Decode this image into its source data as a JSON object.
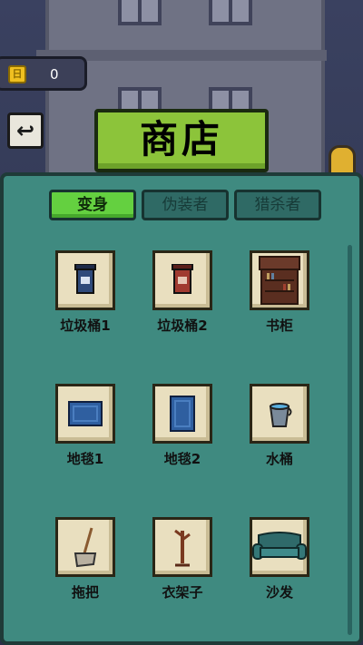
{
  "currency": {
    "count": "0",
    "icon": "coin-icon",
    "icon_glyph": "日"
  },
  "back": {
    "icon": "undo-arrow-icon",
    "glyph": "↩"
  },
  "title": "商店",
  "tabs": [
    {
      "label": "变身",
      "active": true
    },
    {
      "label": "伪装者",
      "active": false
    },
    {
      "label": "猎杀者",
      "active": false
    }
  ],
  "items": [
    {
      "label": "垃圾桶1",
      "icon": "trash-bin-blue-icon"
    },
    {
      "label": "垃圾桶2",
      "icon": "trash-bin-red-icon"
    },
    {
      "label": "书柜",
      "icon": "bookcase-icon"
    },
    {
      "label": "地毯1",
      "icon": "rug-wide-icon"
    },
    {
      "label": "地毯2",
      "icon": "rug-tall-icon"
    },
    {
      "label": "水桶",
      "icon": "water-bucket-icon"
    },
    {
      "label": "拖把",
      "icon": "mop-icon"
    },
    {
      "label": "衣架子",
      "icon": "coat-rack-icon"
    },
    {
      "label": "沙发",
      "icon": "sofa-icon"
    }
  ],
  "colors": {
    "panel": "#3f8a80",
    "title_green": "#8cc43a",
    "tab_active": "#64d040",
    "tile": "#e9dfbf"
  }
}
